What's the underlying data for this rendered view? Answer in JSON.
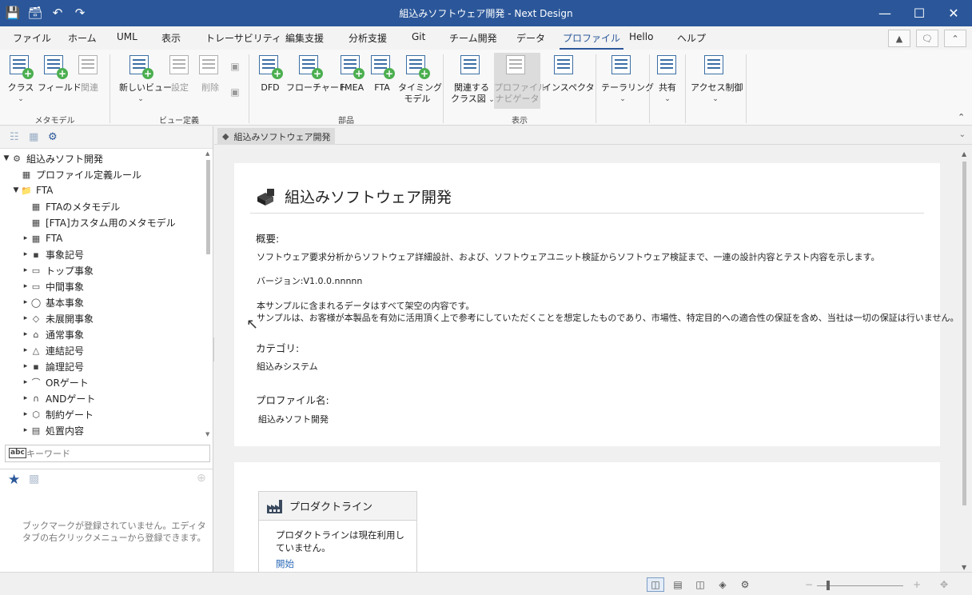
{
  "window": {
    "title": "組込みソフトウェア開発 - Next Design",
    "quick_access": [
      "save-icon",
      "save-all-icon",
      "undo-icon",
      "redo-icon"
    ],
    "controls": [
      "minimize-icon",
      "maximize-icon",
      "close-icon"
    ]
  },
  "menu": {
    "tabs": [
      "ファイル",
      "ホーム",
      "UML",
      "表示",
      "トレーサビリティ",
      "編集支援",
      "分析支援",
      "Git",
      "チーム開発",
      "データ",
      "プロファイル",
      "Hello",
      "ヘルプ"
    ],
    "active": "プロファイル"
  },
  "ribbon": {
    "groups": [
      "メタモデル",
      "ビュー定義",
      "部品",
      "表示"
    ],
    "metamodel": [
      "クラス",
      "フィールド",
      "関連"
    ],
    "view_def": [
      "新しいビュー",
      "設定",
      "削除"
    ],
    "parts": [
      "DFD",
      "フローチャート",
      "FMEA",
      "FTA",
      "タイミング",
      "モデル"
    ],
    "display": [
      "関連する",
      "クラス図",
      "プロファイル",
      "ナビゲータ",
      "インスペクタ"
    ],
    "tailoring": "テーラリング",
    "share": "共有",
    "access": "アクセス制御"
  },
  "tree": {
    "nodes": [
      {
        "label": "組込みソフト開発",
        "icon": "project-icon"
      },
      {
        "label": "プロファイル定義ルール",
        "icon": "rule-icon"
      },
      {
        "label": "FTA",
        "icon": "folder-icon"
      },
      {
        "label": "FTAのメタモデル",
        "icon": "metamodel-icon"
      },
      {
        "label": "[FTA]カスタム用のメタモデル",
        "icon": "metamodel-icon"
      },
      {
        "label": "FTA",
        "icon": "class-icon"
      },
      {
        "label": "事象記号",
        "icon": "symbol-icon"
      },
      {
        "label": "トップ事象",
        "icon": "rect-icon"
      },
      {
        "label": "中間事象",
        "icon": "rect-icon"
      },
      {
        "label": "基本事象",
        "icon": "circle-icon"
      },
      {
        "label": "未展開事象",
        "icon": "diamond-icon"
      },
      {
        "label": "通常事象",
        "icon": "house-icon"
      },
      {
        "label": "連結記号",
        "icon": "triangle-icon"
      },
      {
        "label": "論理記号",
        "icon": "symbol-icon"
      },
      {
        "label": "ORゲート",
        "icon": "or-gate-icon"
      },
      {
        "label": "ANDゲート",
        "icon": "and-gate-icon"
      },
      {
        "label": "制約ゲート",
        "icon": "hexagon-icon"
      },
      {
        "label": "処置内容",
        "icon": "document-icon"
      }
    ]
  },
  "search": {
    "placeholder": "キーワード"
  },
  "bookmarks": {
    "empty_message": "ブックマークが登録されていません。エディタタブの右クリックメニューから登録できます。"
  },
  "editor": {
    "tab_label": "組込みソフトウェア開発",
    "page_title": "組込みソフトウェア開発",
    "overview_label": "概要:",
    "overview_text": "ソフトウェア要求分析からソフトウェア詳細設計、および、ソフトウェアユニット検証からソフトウェア検証まで、一連の設計内容とテスト内容を示します。",
    "version_text": "バージョン:V1.0.0.nnnnn",
    "disclaimer_1": "本サンプルに含まれるデータはすべて架空の内容です。",
    "disclaimer_2": "サンプルは、お客様が本製品を有効に活用頂く上で参考にしていただくことを想定したものであり、市場性、特定目的への適合性の保証を含め、当社は一切の保証は行いません。",
    "category_label": "カテゴリ:",
    "category_value": "組込みシステム",
    "profile_label": "プロファイル名:",
    "profile_value": "組込みソフト開発",
    "product_line": {
      "title": "プロダクトライン",
      "body": "プロダクトラインは現在利用していません。",
      "link": "開始"
    }
  },
  "colors": {
    "accent": "#2b579a",
    "link": "#2b6ab8",
    "plus": "#4caf50"
  }
}
